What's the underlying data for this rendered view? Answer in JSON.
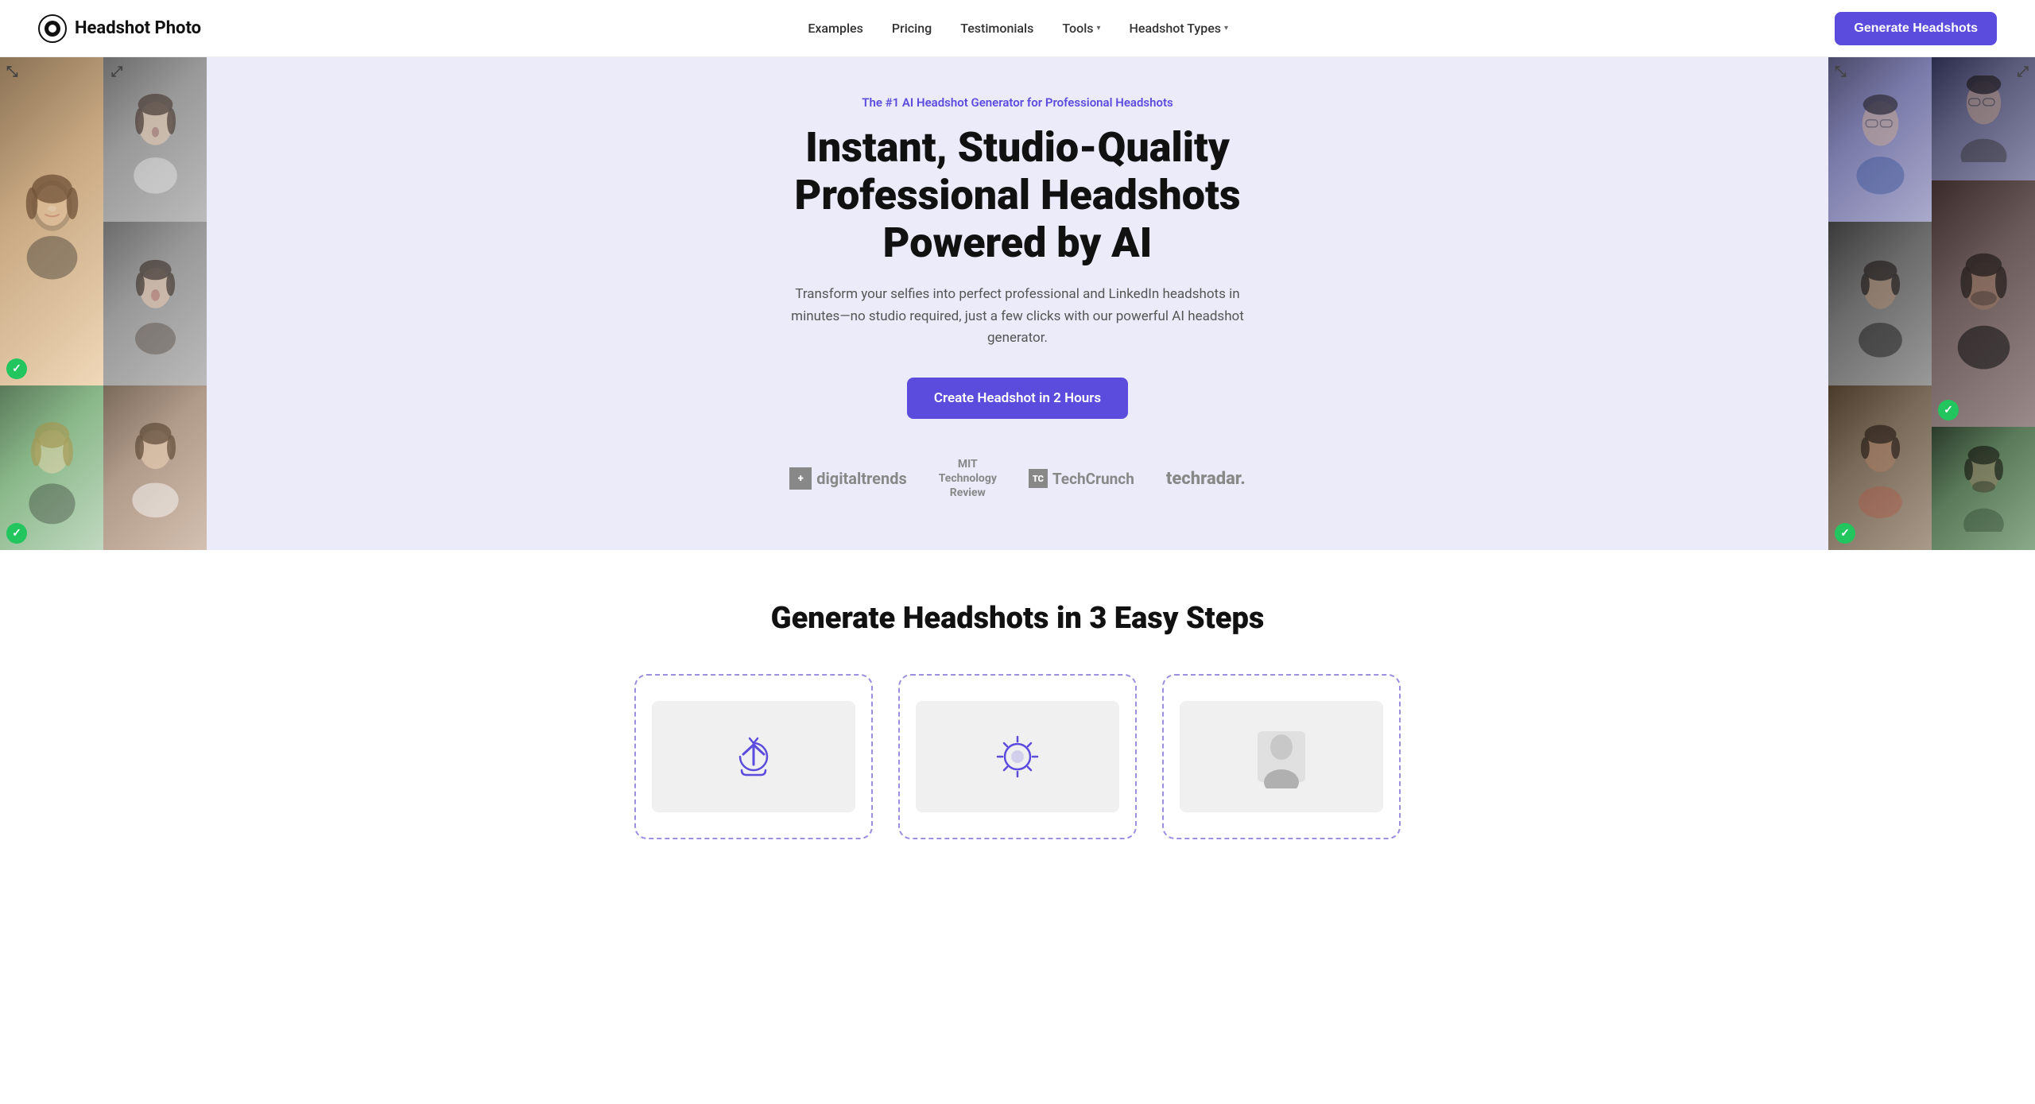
{
  "navbar": {
    "logo_text": "Headshot Photo",
    "nav_items": [
      {
        "label": "Examples",
        "dropdown": false
      },
      {
        "label": "Pricing",
        "dropdown": false
      },
      {
        "label": "Testimonials",
        "dropdown": false
      },
      {
        "label": "Tools",
        "dropdown": true
      },
      {
        "label": "Headshot Types",
        "dropdown": true
      }
    ],
    "cta_label": "Generate Headshots"
  },
  "hero": {
    "tag": "The #1 AI Headshot Generator for Professional Headshots",
    "title": "Instant, Studio-Quality Professional Headshots Powered by AI",
    "subtitle": "Transform your selfies into perfect professional and LinkedIn headshots in minutes—no studio required, just a few clicks with our powerful AI headshot generator.",
    "cta_label": "Create Headshot in 2 Hours",
    "press": [
      {
        "name": "Digital Trends",
        "display": "digitaltrends",
        "type": "dt"
      },
      {
        "name": "MIT Technology Review",
        "display": "MIT Technology Review",
        "type": "mit"
      },
      {
        "name": "TechCrunch",
        "display": "TechCrunch",
        "type": "tc"
      },
      {
        "name": "TechRadar",
        "display": "techradar",
        "type": "tr"
      }
    ]
  },
  "steps_section": {
    "title": "Generate Headshots in 3 Easy Steps"
  },
  "colors": {
    "accent": "#5b4cde",
    "green": "#22c55e",
    "hero_bg": "#ebebfa"
  }
}
